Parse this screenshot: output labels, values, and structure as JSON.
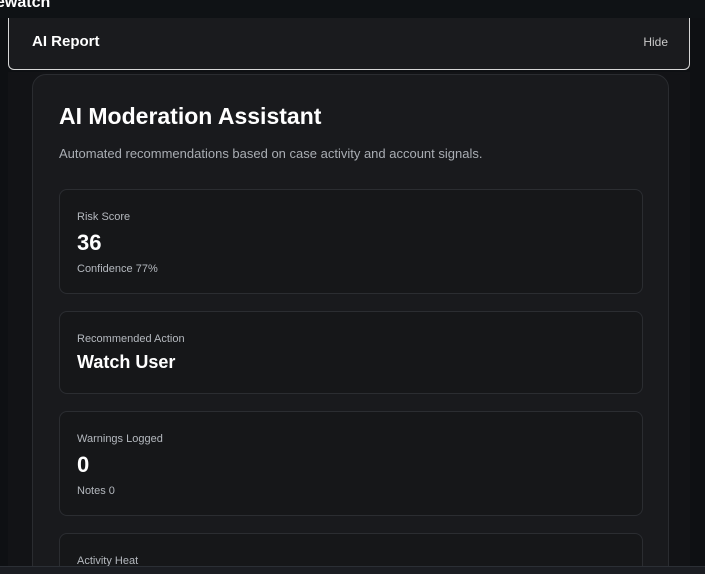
{
  "app": {
    "title": "ewatch"
  },
  "report": {
    "title": "AI Report",
    "hide_label": "Hide"
  },
  "assistant": {
    "title": "AI Moderation Assistant",
    "subtitle": "Automated recommendations based on case activity and account signals."
  },
  "risk": {
    "label": "Risk Score",
    "value": "36",
    "confidence": "Confidence 77%"
  },
  "action": {
    "label": "Recommended Action",
    "value": "Watch User"
  },
  "warnings": {
    "label": "Warnings Logged",
    "value": "0",
    "notes": "Notes 0"
  },
  "heat": {
    "label": "Activity Heat"
  },
  "colors": {
    "background": "#0e1013",
    "card": "#191a1d",
    "header_border": "#d7d7d7",
    "text_primary": "#ffffff",
    "text_muted": "#b4b8be"
  }
}
